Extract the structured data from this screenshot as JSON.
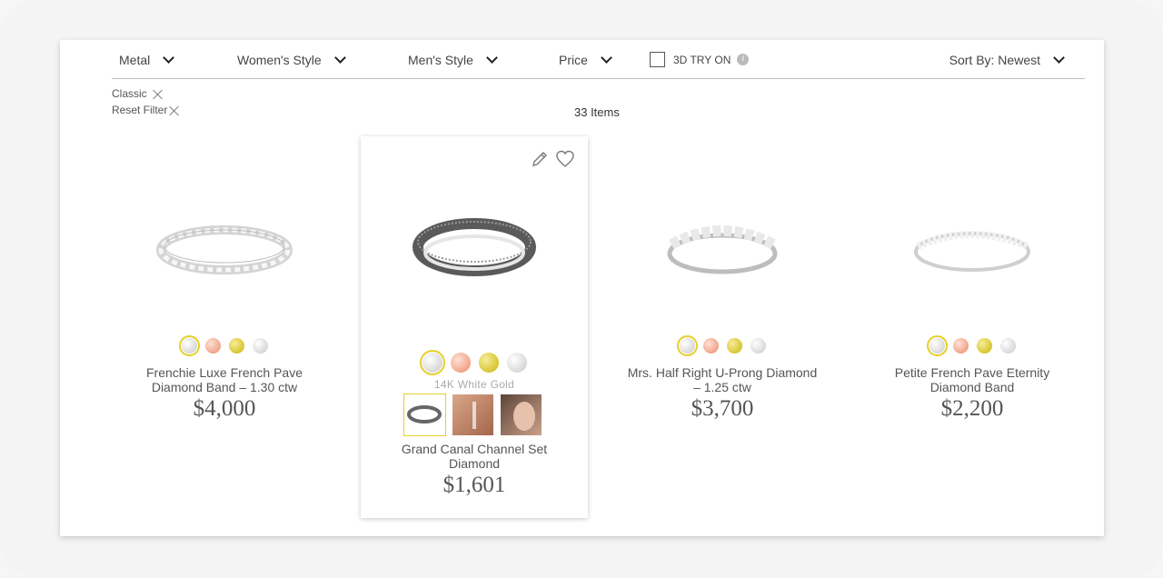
{
  "filters": {
    "metal": "Metal",
    "womens_style": "Women's Style",
    "mens_style": "Men's Style",
    "price": "Price",
    "try_on": "3D TRY ON",
    "try_on_info": "i",
    "sort": "Sort By: Newest"
  },
  "active_filters": {
    "classic": "Classic",
    "reset": "Reset Filter"
  },
  "item_count": "33 Items",
  "colors": {
    "white_gold": "#d8d8d8",
    "rose_gold": "#f2a388",
    "yellow_gold": "#d8c530",
    "selected_ring": "#e6cf29"
  },
  "products": [
    {
      "name": "Frenchie Luxe French Pave Diamond Band – 1.30 ctw",
      "price": "$4,000"
    },
    {
      "name": "Grand Canal Channel Set Diamond",
      "price": "$1,601",
      "metal_label": "14K White Gold"
    },
    {
      "name": "Mrs. Half Right U-Prong Diamond – 1.25 ctw",
      "price": "$3,700"
    },
    {
      "name": "Petite French Pave Eternity Diamond Band",
      "price": "$2,200"
    }
  ]
}
